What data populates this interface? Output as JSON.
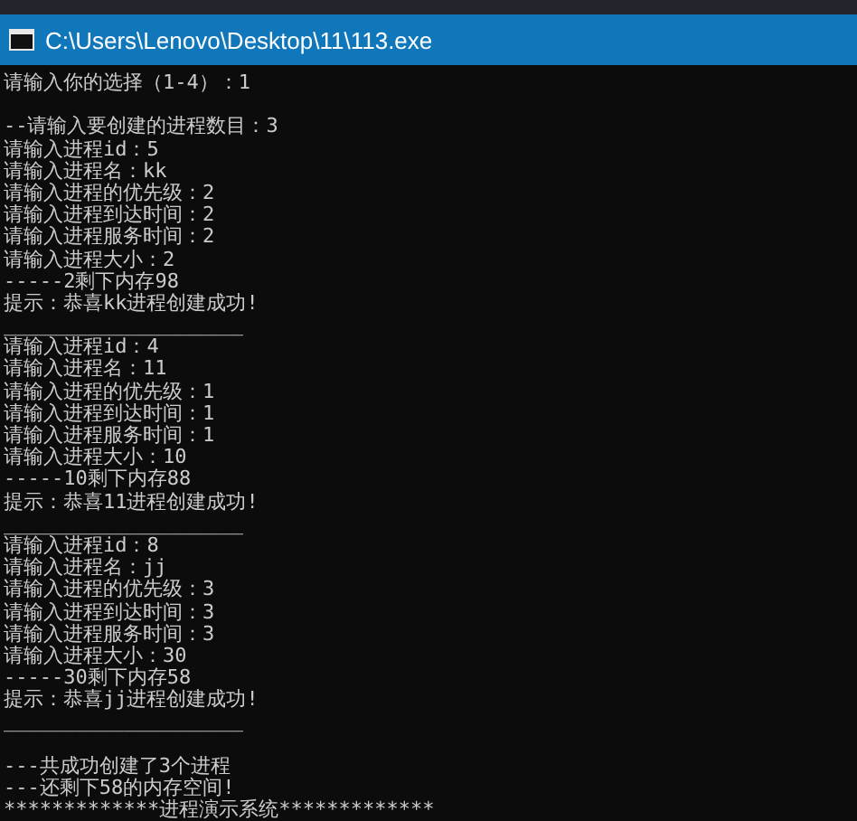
{
  "window": {
    "title": "C:\\Users\\Lenovo\\Desktop\\11\\113.exe"
  },
  "console": {
    "lines": [
      {
        "kind": "text",
        "text": "请输入你的选择（1-4）：1"
      },
      {
        "kind": "blank"
      },
      {
        "kind": "text",
        "text": "--请输入要创建的进程数目：3"
      },
      {
        "kind": "text",
        "text": "请输入进程id：5"
      },
      {
        "kind": "text",
        "text": "请输入进程名：kk"
      },
      {
        "kind": "text",
        "text": "请输入进程的优先级：2"
      },
      {
        "kind": "text",
        "text": "请输入进程到达时间：2"
      },
      {
        "kind": "text",
        "text": "请输入进程服务时间：2"
      },
      {
        "kind": "text",
        "text": "请输入进程大小：2"
      },
      {
        "kind": "text",
        "text": "-----2剩下内存98"
      },
      {
        "kind": "text",
        "text": "提示：恭喜kk进程创建成功!"
      },
      {
        "kind": "text",
        "text": "____________________"
      },
      {
        "kind": "text",
        "text": "请输入进程id：4"
      },
      {
        "kind": "text",
        "text": "请输入进程名：11"
      },
      {
        "kind": "text",
        "text": "请输入进程的优先级：1"
      },
      {
        "kind": "text",
        "text": "请输入进程到达时间：1"
      },
      {
        "kind": "text",
        "text": "请输入进程服务时间：1"
      },
      {
        "kind": "text",
        "text": "请输入进程大小：10"
      },
      {
        "kind": "text",
        "text": "-----10剩下内存88"
      },
      {
        "kind": "text",
        "text": "提示：恭喜11进程创建成功!"
      },
      {
        "kind": "text",
        "text": "____________________"
      },
      {
        "kind": "text",
        "text": "请输入进程id：8"
      },
      {
        "kind": "text",
        "text": "请输入进程名：jj"
      },
      {
        "kind": "text",
        "text": "请输入进程的优先级：3"
      },
      {
        "kind": "text",
        "text": "请输入进程到达时间：3"
      },
      {
        "kind": "text",
        "text": "请输入进程服务时间：3"
      },
      {
        "kind": "text",
        "text": "请输入进程大小：30"
      },
      {
        "kind": "text",
        "text": "-----30剩下内存58"
      },
      {
        "kind": "text",
        "text": "提示：恭喜jj进程创建成功!"
      },
      {
        "kind": "text",
        "text": "____________________"
      },
      {
        "kind": "blank"
      },
      {
        "kind": "text",
        "text": "---共成功创建了3个进程"
      },
      {
        "kind": "text",
        "text": "---还剩下58的内存空间!"
      },
      {
        "kind": "text",
        "text": "*************进程演示系统*************"
      }
    ]
  }
}
